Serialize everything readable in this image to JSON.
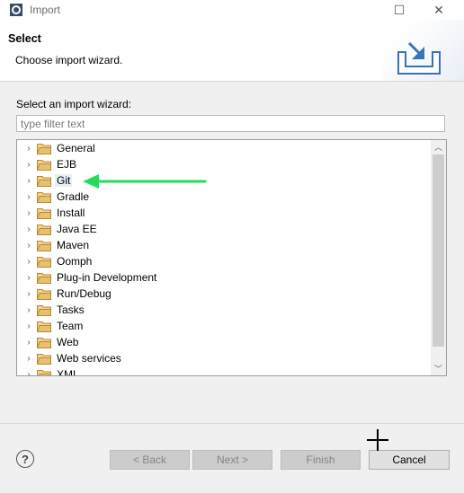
{
  "window": {
    "title": "Import",
    "icon": "eclipse-icon",
    "minimize_glyph": "☐",
    "close_glyph": "✕"
  },
  "header": {
    "title": "Select",
    "description": "Choose import wizard.",
    "graphic": "import-wizard-icon"
  },
  "content": {
    "wizard_label": "Select an import wizard:",
    "filter_placeholder": "type filter text",
    "tree": {
      "items": [
        {
          "label": "General"
        },
        {
          "label": "EJB"
        },
        {
          "label": "Git",
          "highlighted": true
        },
        {
          "label": "Gradle"
        },
        {
          "label": "Install"
        },
        {
          "label": "Java EE"
        },
        {
          "label": "Maven"
        },
        {
          "label": "Oomph"
        },
        {
          "label": "Plug-in Development"
        },
        {
          "label": "Run/Debug"
        },
        {
          "label": "Tasks"
        },
        {
          "label": "Team"
        },
        {
          "label": "Web"
        },
        {
          "label": "Web services"
        },
        {
          "label": "XML"
        }
      ]
    },
    "annotation": {
      "type": "arrow",
      "color": "#22dd55",
      "points_to": "Git"
    }
  },
  "footer": {
    "help_glyph": "?",
    "buttons": {
      "back": "< Back",
      "next": "Next >",
      "finish": "Finish",
      "cancel": "Cancel"
    }
  },
  "colors": {
    "arrow": "#22dd55",
    "folder": "#e8c170"
  }
}
